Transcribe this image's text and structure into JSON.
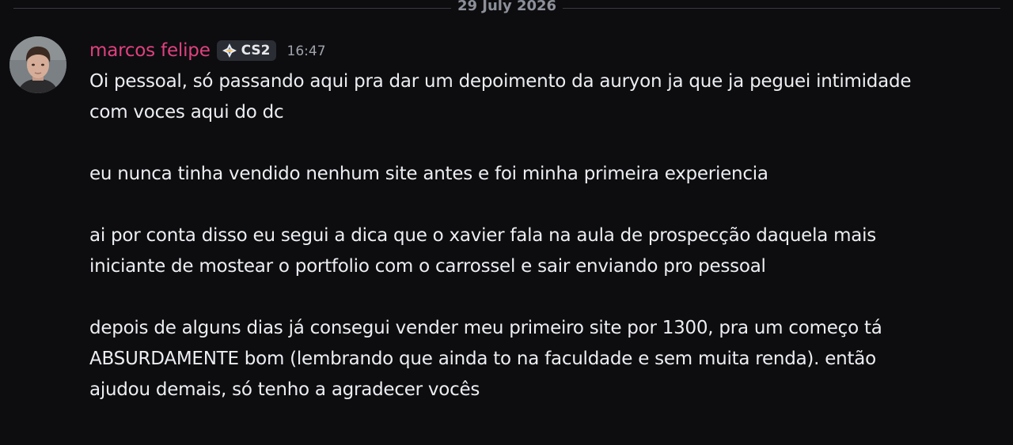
{
  "date_divider": "29 July 2026",
  "message": {
    "author": "marcos felipe",
    "author_color": "#e0417e",
    "tag": {
      "icon": "diamond-sparkle-icon",
      "label": "CS2"
    },
    "timestamp": "16:47",
    "avatar": "avatar-photo",
    "lines": [
      "Oi pessoal, só passando aqui pra dar um depoimento da auryon ja que ja peguei intimidade",
      "com voces aqui do dc",
      "eu nunca tinha vendido nenhum site antes e foi minha primeira experiencia",
      "ai por conta disso eu segui a dica que o xavier fala na aula de prospecção daquela mais",
      "iniciante de mostear o portfolio com o carrossel e sair enviando pro pessoal",
      "depois de alguns dias já consegui vender meu primeiro site por 1300, pra um começo tá",
      "ABSURDAMENTE bom (lembrando que ainda to na faculdade e sem muita renda). então",
      "ajudou demais, só tenho a agradecer vocês"
    ]
  }
}
